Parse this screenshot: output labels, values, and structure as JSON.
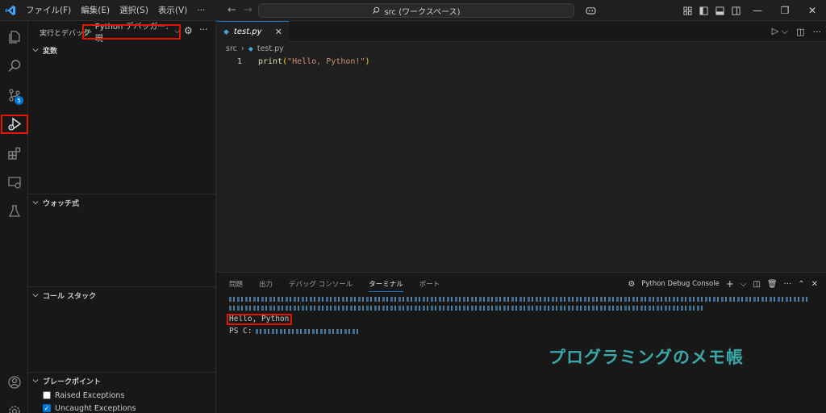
{
  "titlebar": {
    "menus": [
      "ファイル(F)",
      "編集(E)",
      "選択(S)",
      "表示(V)",
      "···"
    ],
    "search_text": "src (ワークスペース)"
  },
  "activitybar": {
    "icons": [
      "explorer-icon",
      "search-icon",
      "source-control-icon",
      "run-debug-icon",
      "extensions-icon",
      "remote-explorer-icon",
      "testing-icon",
      "account-icon",
      "settings-gear-icon"
    ],
    "scm_badge": "5"
  },
  "sidebar": {
    "title": "実行とデバッグ",
    "config_label": "Python デバッガー: 現",
    "sections": {
      "variables": "変数",
      "watch": "ウォッチ式",
      "callstack": "コール スタック",
      "breakpoints": "ブレークポイント"
    },
    "breakpoints": [
      {
        "label": "Raised Exceptions",
        "checked": false
      },
      {
        "label": "Uncaught Exceptions",
        "checked": true
      }
    ]
  },
  "editor": {
    "tab_title": "test.py",
    "breadcrumb": [
      "src",
      "test.py"
    ],
    "line_number": "1",
    "code": {
      "fn": "print",
      "open": "(",
      "str": "\"Hello, Python!\"",
      "close": ")"
    }
  },
  "panel": {
    "tabs": [
      "問題",
      "出力",
      "デバッグ コンソール",
      "ターミナル",
      "ポート"
    ],
    "active_tab": "ターミナル",
    "terminal_name": "Python Debug Console",
    "output_line": "Hello, Python!",
    "prompt": "PS C:"
  },
  "watermark": "プログラミングのメモ帳",
  "colors": {
    "accent": "#0078d4",
    "highlight_box": "#e51400",
    "watermark": "#3aa6a6"
  }
}
